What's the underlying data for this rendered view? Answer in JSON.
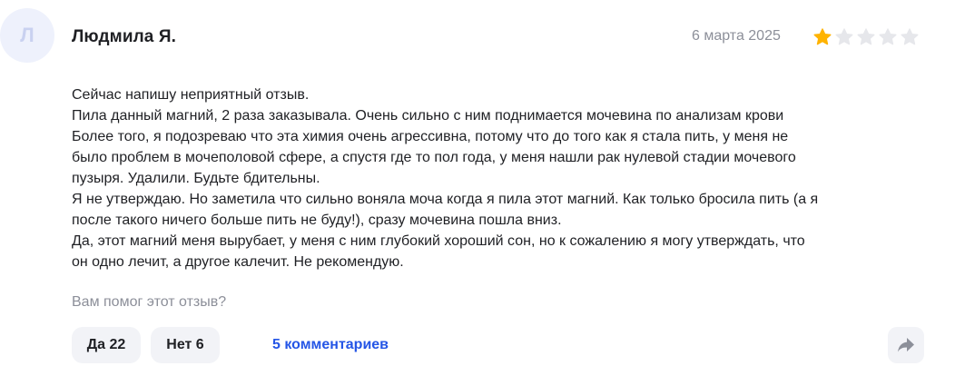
{
  "review": {
    "avatar_letter": "Л",
    "author": "Людмила Я.",
    "date": "6 марта 2025",
    "rating": 1,
    "rating_max": 5,
    "star_color_filled": "#ffb300",
    "star_color_empty": "#e6e7eb",
    "lines": [
      "Сейчас напишу неприятный отзыв.",
      "Пила данный магний, 2 раза заказывала. Очень сильно с ним поднимается мочевина по анализам крови",
      "Более того, я подозреваю что эта химия очень агрессивна, потому что до того как я стала пить, у меня не",
      "было проблем в мочеполовой сфере, а спустя где то пол года, у меня нашли рак нулевой стадии мочевого",
      "пузыря. Удалили. Будьте бдительны.",
      "Я не утверждаю. Но заметила что сильно воняла моча когда я пила этот магний. Как только бросила пить (а я",
      "после такого ничего больше пить не буду!), сразу мочевина пошла вниз.",
      "Да, этот магний меня вырубает, у меня с ним глубокий хороший сон, но к сожалению я могу утверждать, что",
      "он одно лечит, а другое калечит. Не рекомендую."
    ]
  },
  "feedback": {
    "question": "Вам помог этот отзыв?",
    "yes_label": "Да 22",
    "no_label": "Нет 6",
    "comments_label": "5 комментариев",
    "share_icon": "share-arrow-icon"
  }
}
